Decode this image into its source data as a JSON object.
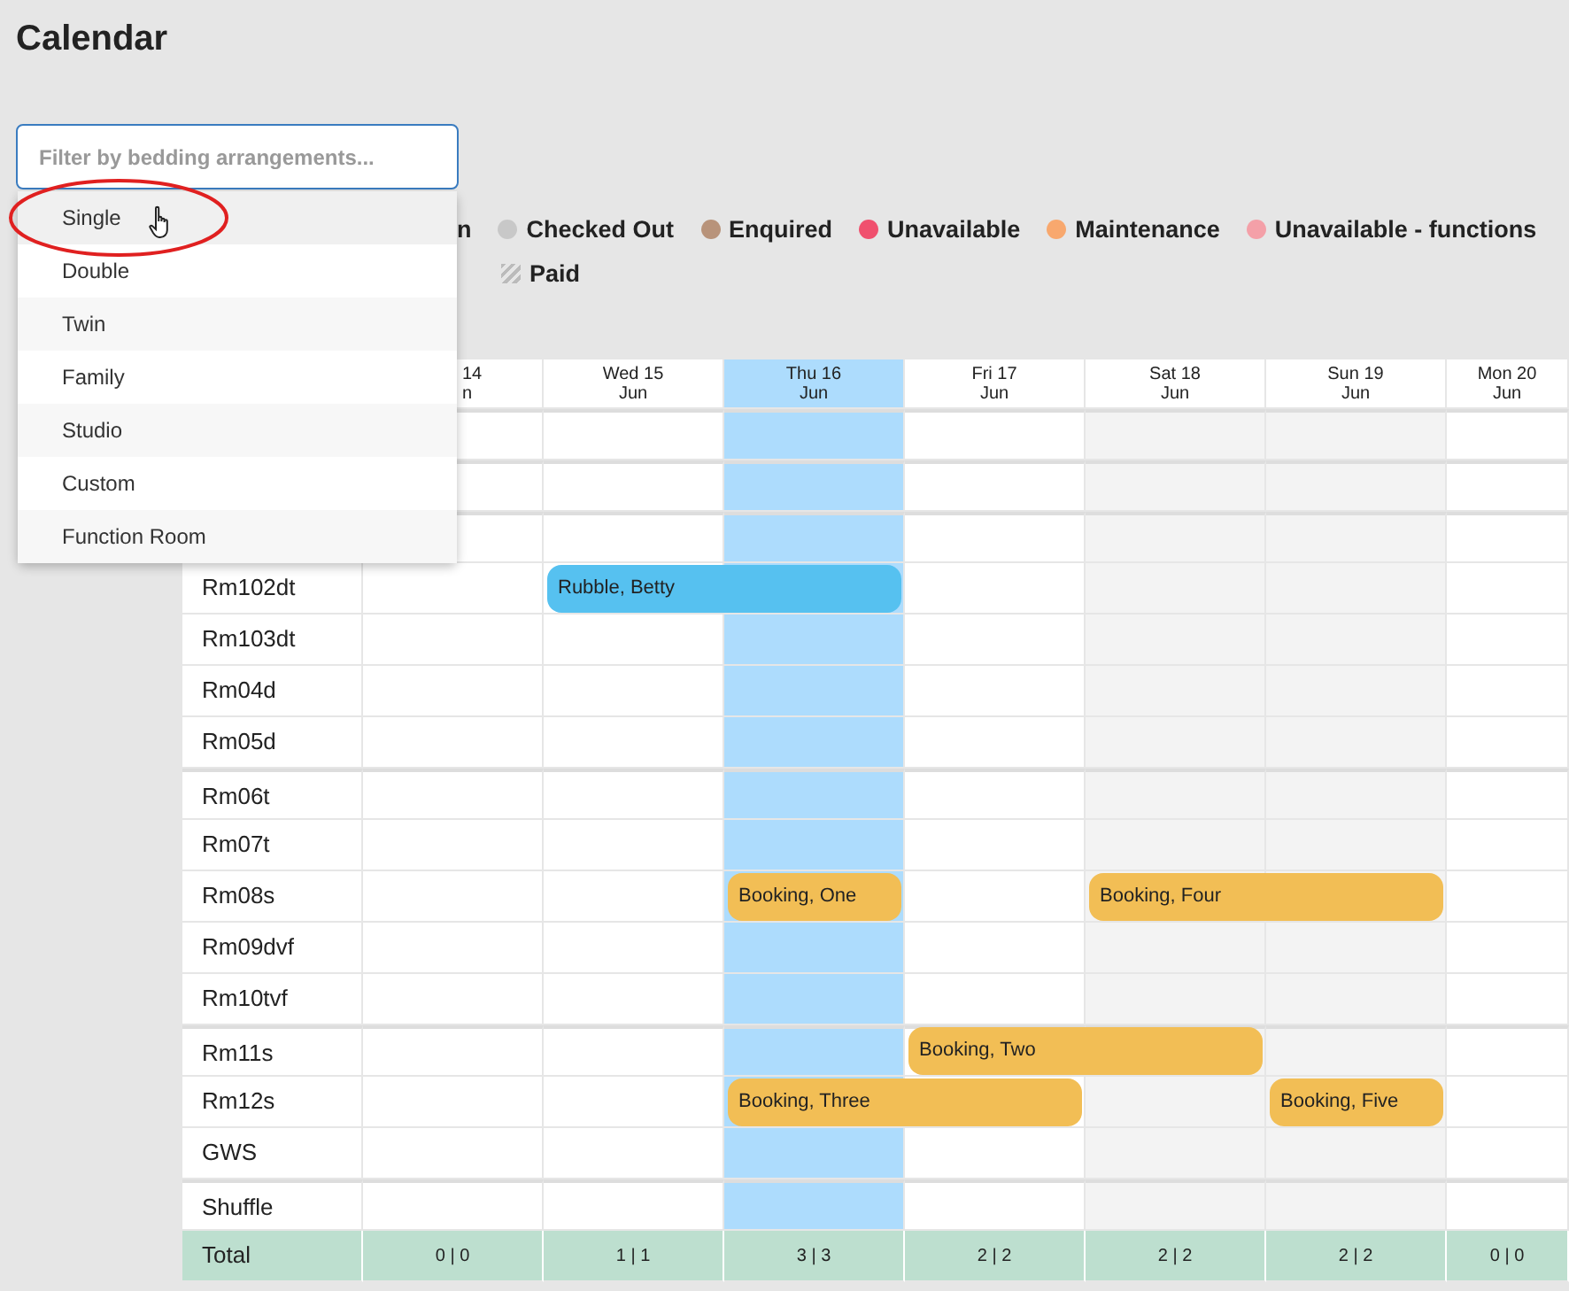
{
  "title": "Calendar",
  "filter": {
    "placeholder": "Filter by bedding arrangements...",
    "options": [
      {
        "label": "Single",
        "selected": true
      },
      {
        "label": "Double",
        "selected": false
      },
      {
        "label": "Twin",
        "selected": false
      },
      {
        "label": "Family",
        "selected": false
      },
      {
        "label": "Studio",
        "selected": false
      },
      {
        "label": "Custom",
        "selected": false
      },
      {
        "label": "Function Room",
        "selected": false
      }
    ]
  },
  "legend": [
    [
      {
        "label": "n",
        "kind": "partial"
      },
      {
        "label": "Checked Out",
        "kind": "dot",
        "color": "#c8c8c8"
      },
      {
        "label": "Enquired",
        "kind": "dot",
        "color": "#b8937a"
      },
      {
        "label": "Unavailable",
        "kind": "dot",
        "color": "#f0506e"
      },
      {
        "label": "Maintenance",
        "kind": "dot",
        "color": "#f8a86e"
      },
      {
        "label": "Unavailable - functions",
        "kind": "dot",
        "color": "#f4a0a8"
      }
    ],
    [
      {
        "label": "Paid",
        "kind": "hatch"
      }
    ]
  ],
  "days": [
    {
      "day": "14",
      "month": "n",
      "kind": "partial"
    },
    {
      "day": "Wed 15",
      "month": "Jun",
      "kind": "normal"
    },
    {
      "day": "Thu 16",
      "month": "Jun",
      "kind": "today"
    },
    {
      "day": "Fri 17",
      "month": "Jun",
      "kind": "normal"
    },
    {
      "day": "Sat 18",
      "month": "Jun",
      "kind": "weekend"
    },
    {
      "day": "Sun 19",
      "month": "Jun",
      "kind": "weekend"
    },
    {
      "day": "Mon 20",
      "month": "Jun",
      "kind": "normal"
    }
  ],
  "rows": [
    {
      "group_start": true
    },
    {
      "group_start": true
    },
    {
      "group_start": true
    },
    {
      "name": "Rm102dt",
      "group_start": false,
      "cells": [
        {
          "kind": "empty"
        },
        {
          "kind": "booking",
          "label": "Rubble, Betty",
          "color": "#56c1f0"
        },
        {
          "kind": "continued"
        },
        {
          "kind": "empty"
        },
        {
          "kind": "empty"
        },
        {
          "kind": "empty"
        },
        {
          "kind": "empty"
        }
      ]
    },
    {
      "name": "Rm103dt",
      "group_start": false
    },
    {
      "name": "Rm04d",
      "group_start": false
    },
    {
      "name": "Rm05d",
      "group_start": false
    },
    {
      "name": "Rm06t",
      "group_start": true
    },
    {
      "name": "Rm07t",
      "group_start": false
    },
    {
      "name": "Rm08s",
      "group_start": false,
      "cells": [
        {
          "kind": "empty"
        },
        {
          "kind": "empty"
        },
        {
          "kind": "booking",
          "label": "Booking, One",
          "color": "#f2be55"
        },
        {
          "kind": "empty"
        },
        {
          "kind": "booking",
          "label": "Booking, Four",
          "color": "#f2be55"
        },
        {
          "kind": "continued"
        },
        {
          "kind": "empty"
        }
      ]
    },
    {
      "name": "Rm09dvf",
      "group_start": false
    },
    {
      "name": "Rm10tvf",
      "group_start": false
    },
    {
      "name": "Rm11s",
      "group_start": true,
      "cells": [
        {
          "kind": "empty"
        },
        {
          "kind": "empty"
        },
        {
          "kind": "empty"
        },
        {
          "kind": "booking",
          "label": "Booking, Two",
          "color": "#f2be55"
        },
        {
          "kind": "continued"
        },
        {
          "kind": "empty"
        },
        {
          "kind": "empty"
        }
      ]
    },
    {
      "name": "Rm12s",
      "group_start": false,
      "cells": [
        {
          "kind": "empty"
        },
        {
          "kind": "empty"
        },
        {
          "kind": "booking",
          "label": "Booking, Three",
          "color": "#f2be55"
        },
        {
          "kind": "continued"
        },
        {
          "kind": "empty"
        },
        {
          "kind": "booking",
          "label": "Booking, Five",
          "color": "#f2be55"
        },
        {
          "kind": "empty"
        }
      ]
    },
    {
      "name": "GWS",
      "group_start": false
    },
    {
      "name": "Shuffle",
      "group_start": true
    }
  ],
  "total": {
    "label": "Total",
    "values": [
      "0 | 0",
      "1 | 1",
      "3 | 3",
      "2 | 2",
      "2 | 2",
      "2 | 2",
      "0 | 0"
    ]
  }
}
